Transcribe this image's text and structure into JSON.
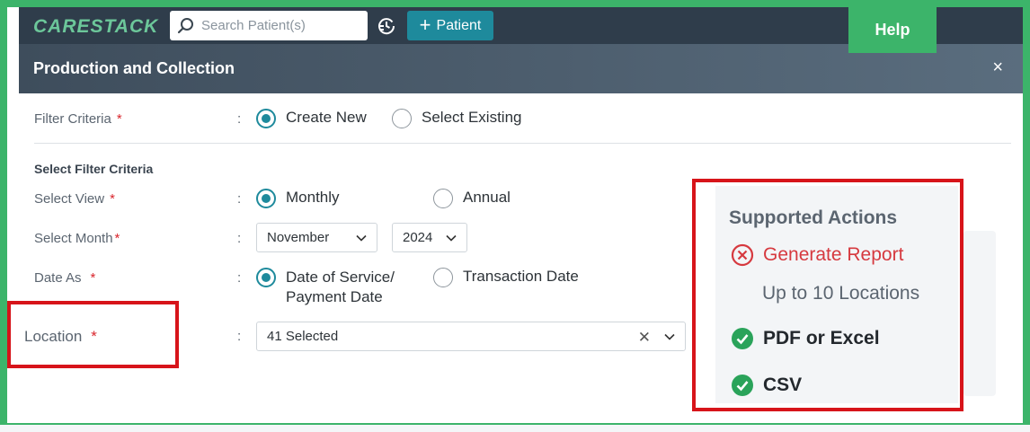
{
  "nav": {
    "logo": "CARESTACK",
    "search_placeholder": "Search Patient(s)",
    "patient_button": "Patient",
    "help_button": "Help"
  },
  "modal": {
    "title": "Production and Collection",
    "close": "×"
  },
  "form": {
    "filter_criteria": {
      "label": "Filter Criteria",
      "required": "*",
      "options": [
        "Create New",
        "Select Existing"
      ],
      "selected": "Create New"
    },
    "section_title": "Select Filter Criteria",
    "select_view": {
      "label": "Select View",
      "required": "*",
      "options": [
        "Monthly",
        "Annual"
      ],
      "selected": "Monthly"
    },
    "select_month": {
      "label": "Select Month",
      "required": "*",
      "month": "November",
      "year": "2024"
    },
    "date_as": {
      "label": "Date As",
      "required": "*",
      "option1_line1": "Date of Service/",
      "option1_line2": "Payment Date",
      "option2": "Transaction Date",
      "selected": "Date of Service/ Payment Date"
    },
    "location": {
      "label": "Location",
      "required": "*",
      "value": "41 Selected"
    },
    "colon": ":"
  },
  "supported_actions": {
    "title": "Supported Actions",
    "generate_report": "Generate Report",
    "generate_report_sub": "Up to 10 Locations",
    "pdf_excel": "PDF or Excel",
    "csv": "CSV"
  },
  "colors": {
    "frame_green": "#3cb46a",
    "accent_teal": "#1e8a9c",
    "highlight_red": "#d7141a",
    "success_green": "#2aa35a",
    "error_red": "#d6393f"
  }
}
